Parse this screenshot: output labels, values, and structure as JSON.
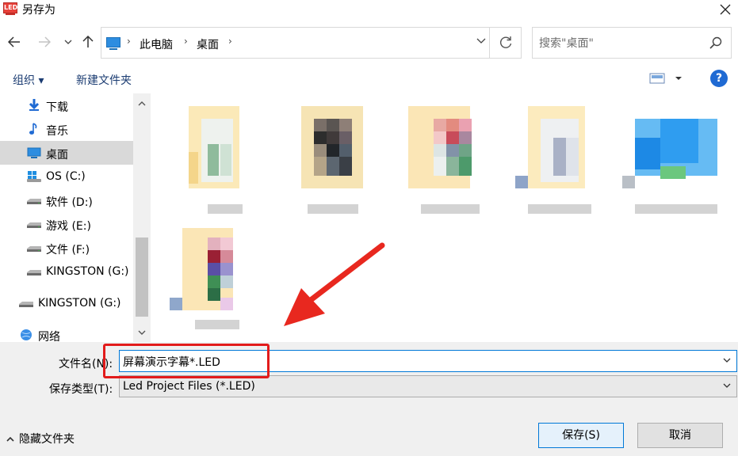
{
  "window": {
    "title": "另存为",
    "app_icon_text": "LED"
  },
  "address": {
    "crumbs": [
      "此电脑",
      "桌面"
    ],
    "search_placeholder": "搜索\"桌面\""
  },
  "toolbar": {
    "organize": "组织 ▾",
    "new_folder": "新建文件夹",
    "help": "?"
  },
  "nav": {
    "items": [
      {
        "label": "下载",
        "icon": "download-icon"
      },
      {
        "label": "音乐",
        "icon": "music-icon"
      },
      {
        "label": "桌面",
        "icon": "desktop-icon"
      },
      {
        "label": "OS (C:)",
        "icon": "windows-drive-icon"
      },
      {
        "label": "软件 (D:)",
        "icon": "drive-icon"
      },
      {
        "label": "游戏 (E:)",
        "icon": "drive-icon"
      },
      {
        "label": "文件 (F:)",
        "icon": "drive-icon"
      },
      {
        "label": "KINGSTON (G:)",
        "icon": "usb-drive-icon"
      },
      {
        "label": "KINGSTON (G:)",
        "icon": "usb-drive-icon"
      },
      {
        "label": "网络",
        "icon": "network-icon"
      }
    ]
  },
  "form": {
    "filename_label": "文件名(N):",
    "filename_value": "屏幕演示字幕*.LED",
    "filetype_label": "保存类型(T):",
    "filetype_value": "Led Project Files (*.LED)",
    "hide_folders": "隐藏文件夹",
    "save": "保存(S)",
    "cancel": "取消"
  },
  "colors": {
    "accent": "#0078d7",
    "highlight": "#cce8ff",
    "annotation": "#e21b1b"
  }
}
